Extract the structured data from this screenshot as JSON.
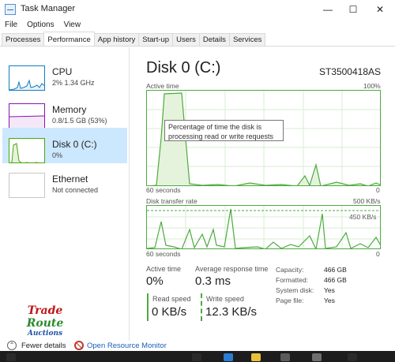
{
  "window": {
    "title": "Task Manager"
  },
  "menu": [
    "File",
    "Options",
    "View"
  ],
  "tabs": [
    {
      "label": "Processes",
      "active": false
    },
    {
      "label": "Performance",
      "active": true
    },
    {
      "label": "App history",
      "active": false
    },
    {
      "label": "Start-up",
      "active": false
    },
    {
      "label": "Users",
      "active": false
    },
    {
      "label": "Details",
      "active": false
    },
    {
      "label": "Services",
      "active": false
    }
  ],
  "sidebar": {
    "items": [
      {
        "name": "CPU",
        "sub": "2% 1.34 GHz",
        "color": "#117dbb"
      },
      {
        "name": "Memory",
        "sub": "0.8/1.5 GB (53%)",
        "color": "#8b12ae"
      },
      {
        "name": "Disk 0 (C:)",
        "sub": "0%",
        "color": "#4da60c"
      },
      {
        "name": "Ethernet",
        "sub": "Not connected",
        "color": "#a7a7a7"
      }
    ]
  },
  "main": {
    "title": "Disk 0 (C:)",
    "model": "ST3500418AS",
    "active_time": {
      "label": "Active time",
      "max": "100%",
      "time": "60 seconds",
      "min": "0"
    },
    "tooltip": "Percentage of time the disk is processing read or write requests",
    "transfer": {
      "label": "Disk transfer rate",
      "max": "500 KB/s",
      "mid": "450 KB/s",
      "time": "60 seconds",
      "min": "0"
    },
    "stats": {
      "active_time_label": "Active time",
      "active_time_value": "0%",
      "response_label": "Average response time",
      "response_value": "0.3 ms",
      "read_label": "Read speed",
      "read_value": "0 KB/s",
      "write_label": "Write speed",
      "write_value": "12.3 KB/s"
    },
    "details": [
      {
        "key": "Capacity:",
        "value": "466 GB"
      },
      {
        "key": "Formatted:",
        "value": "466 GB"
      },
      {
        "key": "System disk:",
        "value": "Yes"
      },
      {
        "key": "Page file:",
        "value": "Yes"
      }
    ]
  },
  "logo": {
    "line1": "Trade",
    "line2": "Route",
    "line3": "Auctions"
  },
  "footer": {
    "fewer_details": "Fewer details",
    "open_monitor": "Open Resource Monitor"
  },
  "colors": {
    "accent_green": "#4cab3e",
    "fill_green": "#e6f3dc",
    "selected_bg": "#cce8ff",
    "link": "#1a5fb4"
  }
}
